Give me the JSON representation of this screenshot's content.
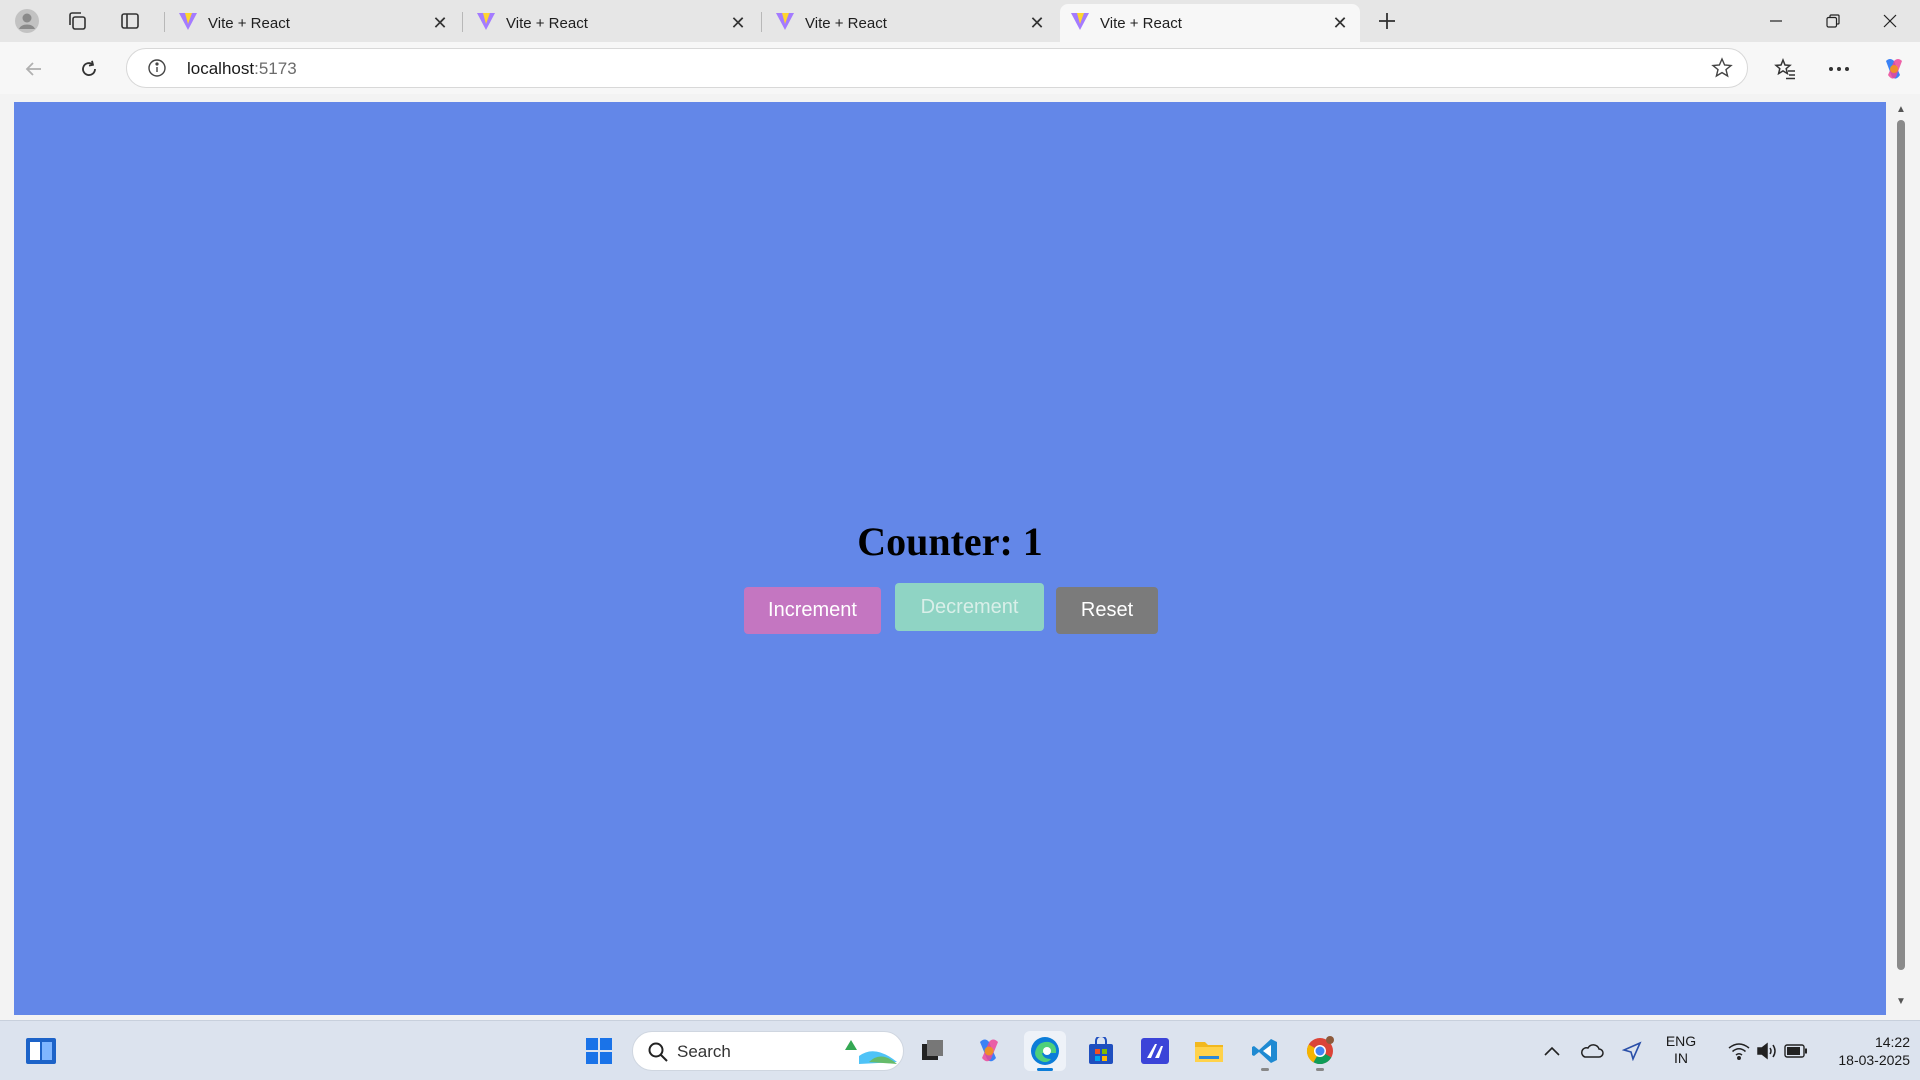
{
  "browser": {
    "tabs": [
      {
        "title": "Vite + React"
      },
      {
        "title": "Vite + React"
      },
      {
        "title": "Vite + React"
      },
      {
        "title": "Vite + React",
        "active": true
      }
    ],
    "address": {
      "host": "localhost",
      "port": ":5173"
    }
  },
  "page": {
    "counter_text": "Counter: 1",
    "buttons": {
      "increment": "Increment",
      "decrement": "Decrement",
      "reset": "Reset"
    },
    "colors": {
      "background": "#6387e8",
      "increment": "#c476c1",
      "decrement": "#8fd4c4",
      "reset": "#7b7b7b"
    }
  },
  "taskbar": {
    "search_label": "Search",
    "language": "ENG",
    "region": "IN",
    "time": "14:22",
    "date": "18-03-2025"
  }
}
